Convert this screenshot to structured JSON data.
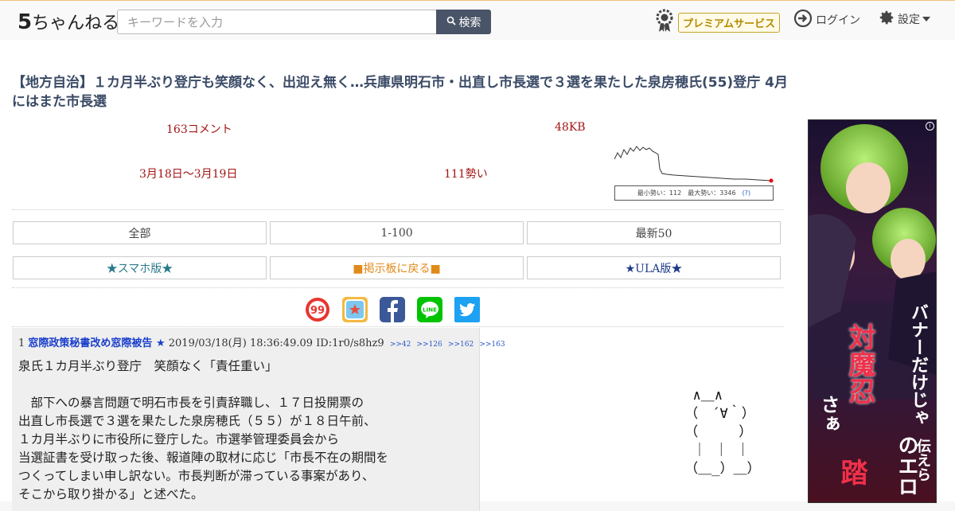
{
  "header": {
    "logo_num": "5",
    "logo_text": "ちゃんねる",
    "search_placeholder": "キーワードを入力",
    "search_button": "検索",
    "premium_label": "プレミアムサービス",
    "login_label": "ログイン",
    "settings_label": "設定"
  },
  "thread": {
    "title": "【地方自治】１カ月半ぶり登庁も笑顔なく、出迎え無く…兵庫県明石市・出直し市長選で３選を果たした泉房穂氏(55)登庁 4月にはまた市長選",
    "comments": "163コメント",
    "size": "48KB",
    "date_range": "3月18日〜3月19日",
    "momentum": "111勢い",
    "chart_legend": {
      "min_label": "最小勢い：112",
      "max_label": "最大勢い：3346",
      "help": "(?)"
    }
  },
  "nav": {
    "all": "全部",
    "range": "1-100",
    "latest": "最新50",
    "smartphone": "★スマホ版★",
    "back_to_board": "■掲示板に戻る■",
    "ula": "★ULA版★"
  },
  "colors": {
    "accent": "#a31515",
    "name": "#1a3ecc",
    "smartphone_link": "#2a7a8a",
    "board_link": "#e08a1a",
    "ula_link": "#1e3a8a"
  },
  "post": {
    "number": "1",
    "name": "窓際政策秘書改め窓際被告 ★",
    "datetime": "2019/03/18(月) 18:36:49.09",
    "id": "ID:1r0/s8hz9",
    "anchors": [
      ">>42",
      ">>126",
      ">>162",
      ">>163"
    ],
    "body": "泉氏１カ月半ぶり登庁　笑顔なく「責任重い」\n\n　部下への暴言問題で明石市長を引責辞職し、１７日投開票の\n出直し市長選で３選を果たした泉房穂氏（５５）が１８日午前、\n１カ月半ぶりに市役所に登庁した。市選挙管理委員会から\n当選証書を受け取った後、報道陣の取材に応じ「市長不在の期間を\nつくってしまい申し訳ない。市長判断が滞っている事案があり、\nそこから取り掛かる」と述べた。"
  },
  "ascii_art": "  ∧＿∧\n （　´∀｀）\n （　　　）\n  ｜ ｜ ｜\n （＿_）＿）",
  "ad": {
    "line1": "バナーだけじゃ",
    "line2": "対魔忍",
    "line3": "のエロ",
    "line4": "伝えら",
    "line5": "さぁ",
    "line6": "踏"
  }
}
